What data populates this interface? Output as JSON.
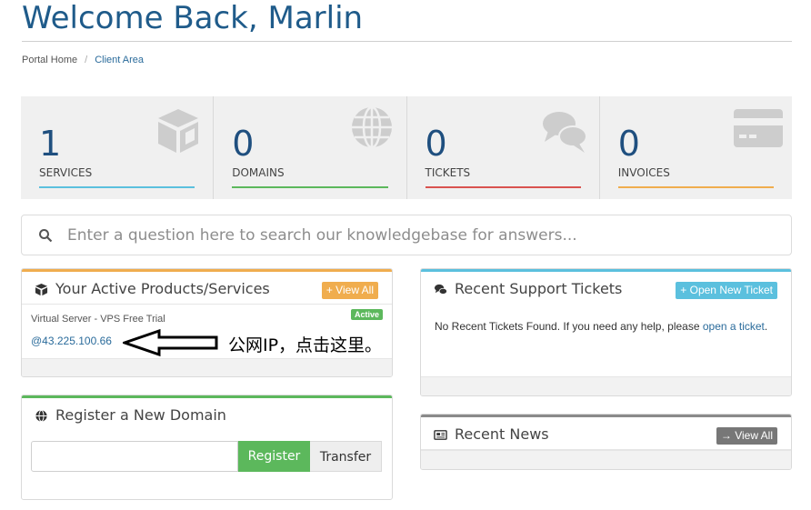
{
  "header": {
    "title": "Welcome Back, Marlin"
  },
  "breadcrumb": {
    "home": "Portal Home",
    "separator": "/",
    "current": "Client Area"
  },
  "stats": [
    {
      "value": "1",
      "label": "SERVICES",
      "color": "#5bc0de",
      "icon": "cube-icon"
    },
    {
      "value": "0",
      "label": "DOMAINS",
      "color": "#5cb85c",
      "icon": "globe-icon"
    },
    {
      "value": "0",
      "label": "TICKETS",
      "color": "#d9534f",
      "icon": "comments-icon"
    },
    {
      "value": "0",
      "label": "INVOICES",
      "color": "#f0ad4e",
      "icon": "credit-card-icon"
    }
  ],
  "search": {
    "placeholder": "Enter a question here to search our knowledgebase for answers..."
  },
  "products_panel": {
    "title": "Your Active Products/Services",
    "view_all": "+ View All",
    "accent": "#f0ad4e",
    "service_name": "Virtual Server - VPS Free Trial",
    "status": "Active",
    "ip": "@43.225.100.66"
  },
  "annotation": {
    "text": "公网IP，点击这里。"
  },
  "domain_panel": {
    "title": "Register a New Domain",
    "accent": "#5cb85c",
    "register": "Register",
    "transfer": "Transfer"
  },
  "tickets_panel": {
    "title": "Recent Support Tickets",
    "open_new": "+ Open New Ticket",
    "accent": "#5bc0de",
    "message": "No Recent Tickets Found. If you need any help, please ",
    "link": "open a ticket",
    "message_end": "."
  },
  "news_panel": {
    "title": "Recent News",
    "view_all": "→ View All",
    "accent": "#8a8a8a"
  }
}
